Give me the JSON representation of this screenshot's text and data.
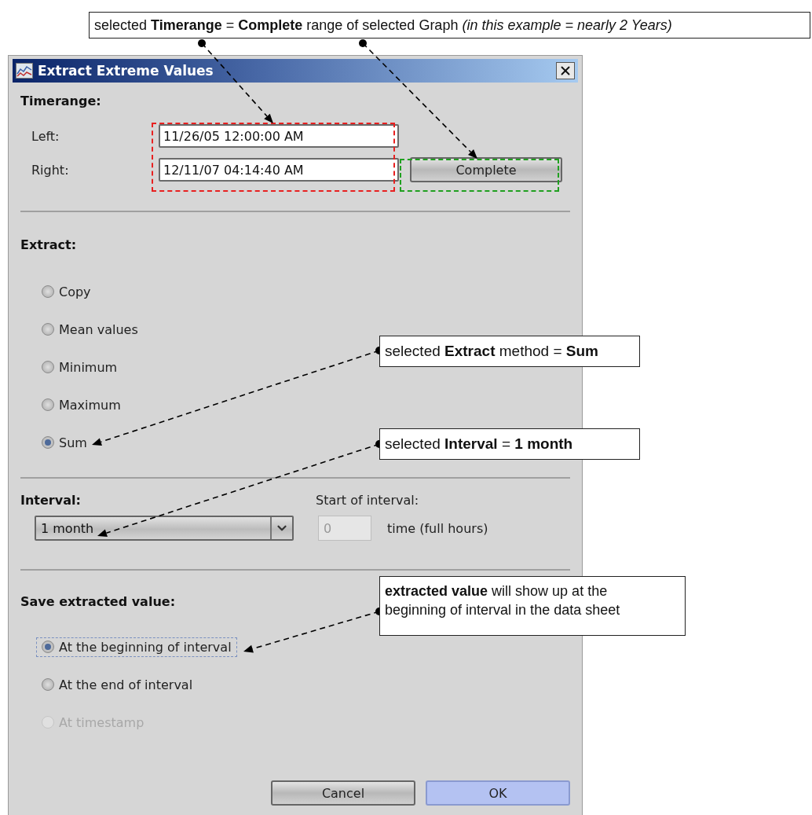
{
  "dialog": {
    "title": "Extract Extreme Values",
    "timerange": {
      "heading": "Timerange:",
      "left_label": "Left:",
      "left_value": "11/26/05 12:00:00 AM",
      "right_label": "Right:",
      "right_value": "12/11/07 04:14:40 AM",
      "complete_button": "Complete"
    },
    "extract": {
      "heading": "Extract:",
      "options": [
        {
          "label": "Copy",
          "selected": false
        },
        {
          "label": "Mean values",
          "selected": false
        },
        {
          "label": "Minimum",
          "selected": false
        },
        {
          "label": "Maximum",
          "selected": false
        },
        {
          "label": "Sum",
          "selected": true
        }
      ]
    },
    "interval": {
      "heading": "Interval:",
      "value": "1 month",
      "start_label": "Start of interval:",
      "start_value": "0",
      "start_disabled": true,
      "unit": "time (full hours)"
    },
    "save": {
      "heading": "Save extracted value:",
      "options": [
        {
          "label": "At the beginning of interval",
          "selected": true,
          "focused": true,
          "disabled": false
        },
        {
          "label": "At the end of interval",
          "selected": false,
          "focused": false,
          "disabled": false
        },
        {
          "label": "At timestamp",
          "selected": false,
          "focused": false,
          "disabled": true
        }
      ]
    },
    "buttons": [
      {
        "label": "Cancel",
        "default": false
      },
      {
        "label": "OK",
        "default": true
      }
    ]
  },
  "annotations": [
    {
      "text": "selected **Timerange** = **Complete** range of selected Graph  *(in this example = nearly 2 Years)*"
    },
    {
      "text": "selected **Extract** method = **Sum**"
    },
    {
      "text": "selected **Interval** = **1 month**"
    },
    {
      "text": "**extracted value** will show up at the beginning of interval in the data sheet"
    }
  ]
}
